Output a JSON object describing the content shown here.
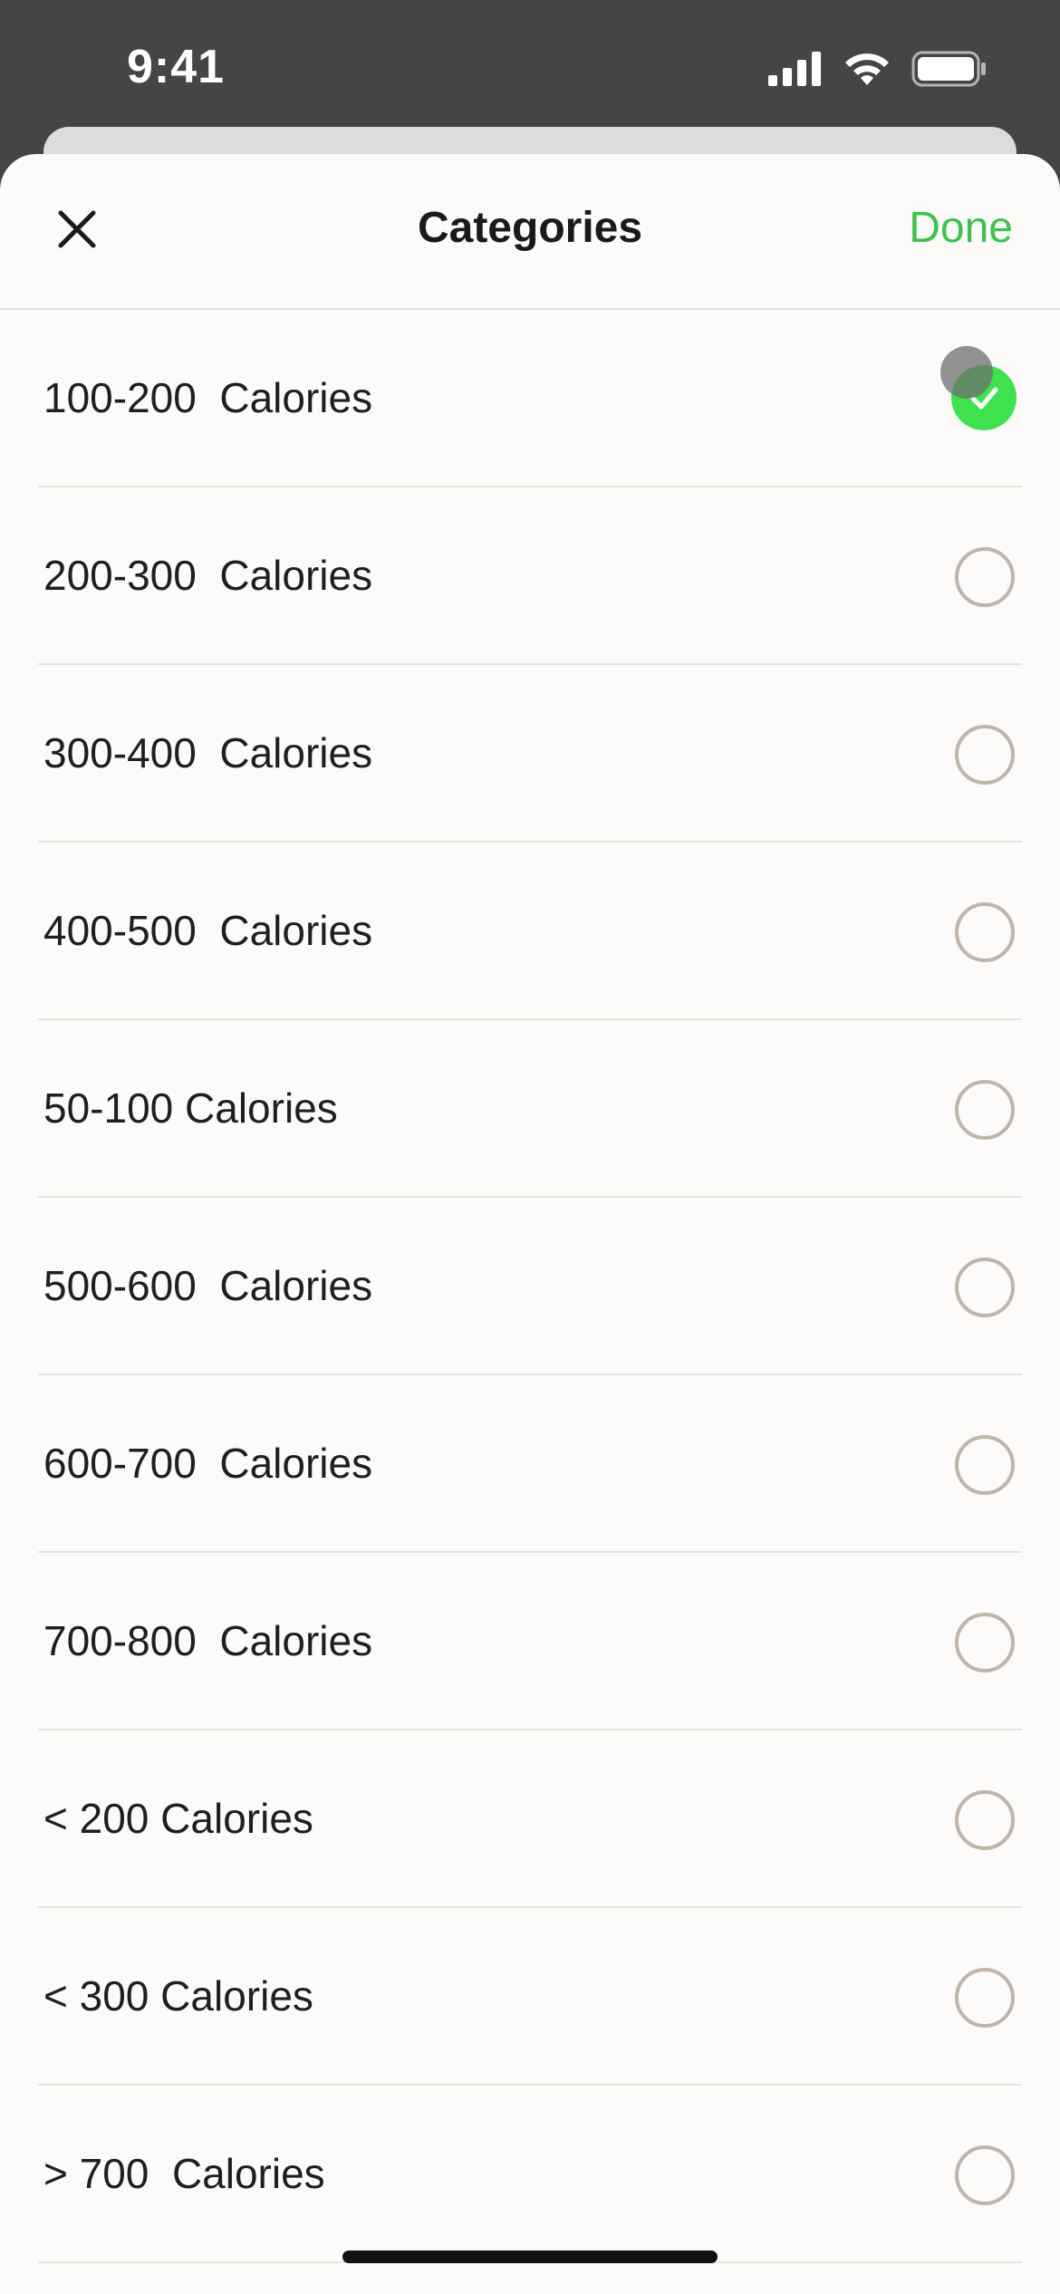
{
  "status_bar": {
    "time": "9:41",
    "icons": [
      "cellular-signal-icon",
      "wifi-icon",
      "battery-icon"
    ]
  },
  "header": {
    "close_icon": "close-icon",
    "title": "Categories",
    "done_label": "Done"
  },
  "colors": {
    "accent": "#3ec24e",
    "checked_fill": "#3ee24e",
    "radio_border": "#bfb5aa",
    "sheet_background": "#fcfbfa",
    "backdrop": "#454446"
  },
  "categories": [
    {
      "label": "100-200  Calories",
      "selected": true
    },
    {
      "label": "200-300  Calories",
      "selected": false
    },
    {
      "label": "300-400  Calories",
      "selected": false
    },
    {
      "label": "400-500  Calories",
      "selected": false
    },
    {
      "label": "50-100 Calories",
      "selected": false
    },
    {
      "label": "500-600  Calories",
      "selected": false
    },
    {
      "label": "600-700  Calories",
      "selected": false
    },
    {
      "label": "700-800  Calories",
      "selected": false
    },
    {
      "label": "< 200 Calories",
      "selected": false
    },
    {
      "label": "< 300 Calories",
      "selected": false
    },
    {
      "label": "> 700  Calories",
      "selected": false
    }
  ]
}
